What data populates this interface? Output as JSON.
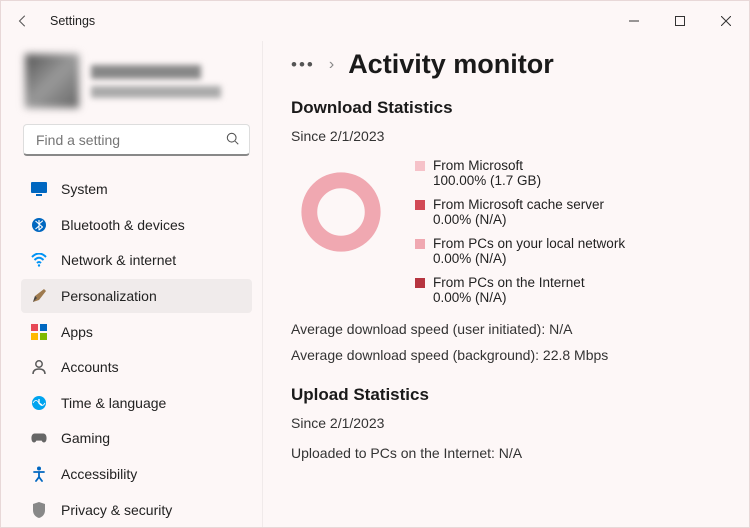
{
  "titlebar": {
    "title": "Settings"
  },
  "search": {
    "placeholder": "Find a setting"
  },
  "nav": [
    {
      "label": "System"
    },
    {
      "label": "Bluetooth & devices"
    },
    {
      "label": "Network & internet"
    },
    {
      "label": "Personalization"
    },
    {
      "label": "Apps"
    },
    {
      "label": "Accounts"
    },
    {
      "label": "Time & language"
    },
    {
      "label": "Gaming"
    },
    {
      "label": "Accessibility"
    },
    {
      "label": "Privacy & security"
    }
  ],
  "breadcrumb": {
    "sep": "›",
    "title": "Activity monitor"
  },
  "download": {
    "heading": "Download Statistics",
    "since": "Since 2/1/2023",
    "legend": [
      {
        "color": "#f6c2c9",
        "label": "From Microsoft",
        "value": "100.00%  (1.7 GB)"
      },
      {
        "color": "#d24a56",
        "label": "From Microsoft cache server",
        "value": "0.00%  (N/A)"
      },
      {
        "color": "#f0a8b1",
        "label": "From PCs on your local network",
        "value": "0.00%  (N/A)"
      },
      {
        "color": "#b63540",
        "label": "From PCs on the Internet",
        "value": "0.00%  (N/A)"
      }
    ],
    "avg_user": "Average download speed (user initiated):   N/A",
    "avg_bg": "Average download speed (background):  22.8 Mbps"
  },
  "upload": {
    "heading": "Upload Statistics",
    "since": "Since 2/1/2023",
    "uploaded": "Uploaded to PCs on the Internet: N/A"
  },
  "chart_data": {
    "type": "pie",
    "title": "Download Statistics",
    "categories": [
      "From Microsoft",
      "From Microsoft cache server",
      "From PCs on your local network",
      "From PCs on the Internet"
    ],
    "values": [
      100.0,
      0.0,
      0.0,
      0.0
    ],
    "bytes": [
      "1.7 GB",
      "N/A",
      "N/A",
      "N/A"
    ],
    "colors": [
      "#f6c2c9",
      "#d24a56",
      "#f0a8b1",
      "#b63540"
    ],
    "donut": true
  }
}
